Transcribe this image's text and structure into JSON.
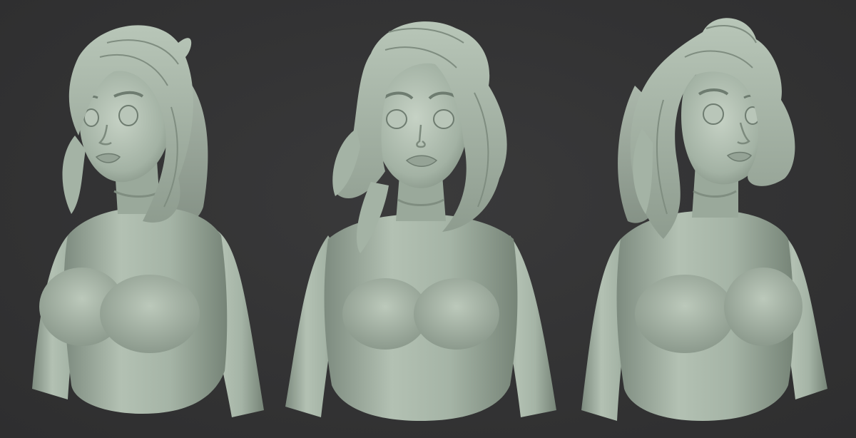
{
  "scene": {
    "background_color": "#333334",
    "clay_color": "#a9b8aa",
    "clay_shadow_color": "#6f7d71",
    "clay_highlight_color": "#c9d5c8",
    "views": [
      {
        "name": "three-quarter-left",
        "facing": "left"
      },
      {
        "name": "front",
        "facing": "front"
      },
      {
        "name": "three-quarter-right",
        "facing": "right"
      }
    ]
  }
}
